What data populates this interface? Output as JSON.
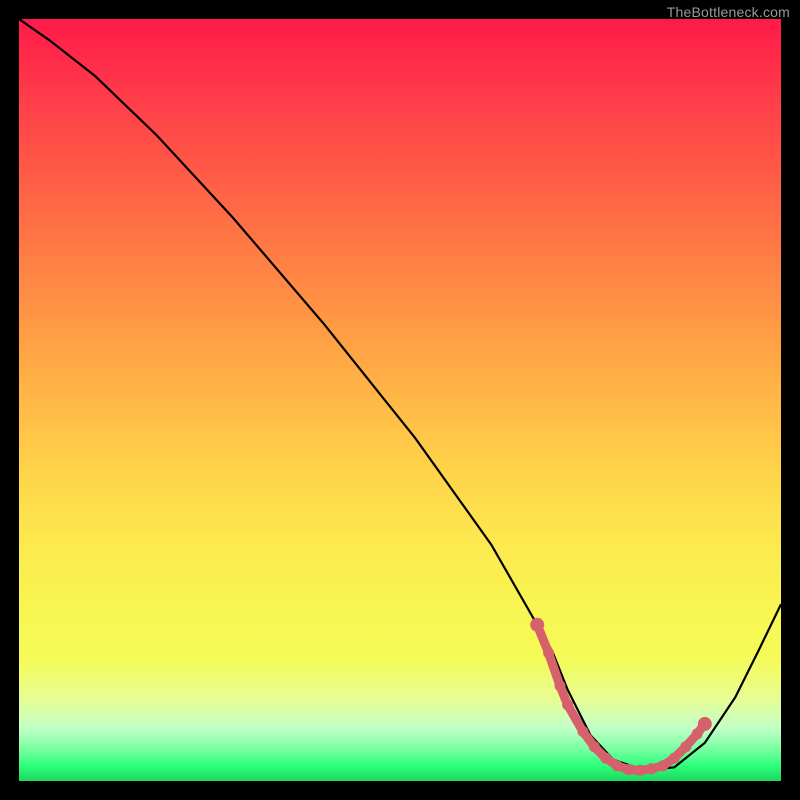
{
  "watermark": "TheBottleneck.com",
  "colors": {
    "curve": "#000000",
    "markers": "#d6606c"
  },
  "chart_data": {
    "type": "line",
    "title": "",
    "xlabel": "",
    "ylabel": "",
    "xlim": [
      0,
      1
    ],
    "ylim": [
      0,
      1
    ],
    "series": [
      {
        "name": "curve",
        "x": [
          0.0,
          0.04,
          0.1,
          0.18,
          0.28,
          0.4,
          0.52,
          0.62,
          0.7,
          0.72,
          0.75,
          0.78,
          0.82,
          0.86,
          0.9,
          0.94,
          0.97,
          1.0
        ],
        "y": [
          1.0,
          0.972,
          0.925,
          0.848,
          0.74,
          0.6,
          0.45,
          0.31,
          0.17,
          0.12,
          0.06,
          0.028,
          0.014,
          0.018,
          0.05,
          0.11,
          0.17,
          0.232
        ]
      }
    ],
    "markers": {
      "name": "highlight-band",
      "x": [
        0.68,
        0.695,
        0.71,
        0.72,
        0.74,
        0.755,
        0.77,
        0.785,
        0.8,
        0.815,
        0.83,
        0.845,
        0.86,
        0.875,
        0.89,
        0.9
      ],
      "y": [
        0.205,
        0.168,
        0.125,
        0.1,
        0.065,
        0.045,
        0.03,
        0.02,
        0.015,
        0.014,
        0.016,
        0.02,
        0.03,
        0.045,
        0.062,
        0.075
      ]
    }
  }
}
